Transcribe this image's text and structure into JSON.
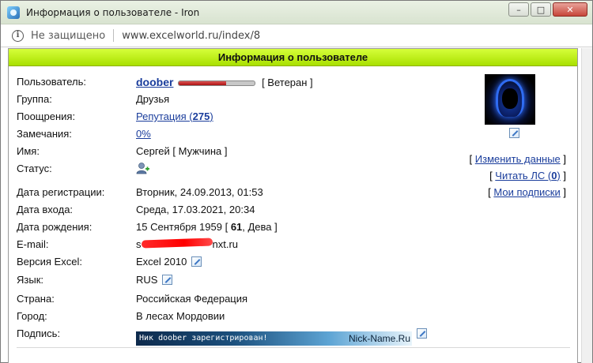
{
  "window": {
    "title": "Информация о пользователе - Iron",
    "controls": {
      "minimize": "–",
      "maximize": "□",
      "close": "✕"
    }
  },
  "address": {
    "security": "Не защищено",
    "url": "www.excelworld.ru/index/8"
  },
  "page": {
    "header": "Информация о пользователе"
  },
  "profile": {
    "username_label": "Пользователь:",
    "username": "doober",
    "reputation_bar_fill": 0.62,
    "rank": "[ Ветеран ]",
    "group_label": "Группа:",
    "group": "Друзья",
    "rewards_label": "Поощрения:",
    "reputation_prefix": "Репутация (",
    "reputation_value": "275",
    "reputation_suffix": ")",
    "warnings_label": "Замечания:",
    "warnings": "0%",
    "name_label": "Имя:",
    "name": "Сергей [ Мужчина ]",
    "status_label": "Статус:",
    "reg_label": "Дата регистрации:",
    "reg_date": "Вторник, 24.09.2013, 01:53",
    "login_label": "Дата входа:",
    "login_date": "Среда, 17.03.2021, 20:34",
    "birth_label": "Дата рождения:",
    "birth_prefix": "15 Сентября 1959 [ ",
    "birth_age": "61",
    "birth_suffix": ", Дева ]",
    "email_label": "E-mail:",
    "email_visible_start": "s",
    "email_visible_end": "nxt.ru",
    "excel_label": "Версия Excel:",
    "excel": "Excel 2010",
    "lang_label": "Язык:",
    "lang": "RUS",
    "country_label": "Страна:",
    "country": "Российская Федерация",
    "city_label": "Город:",
    "city": "В лесах Мордовии",
    "signature_label": "Подпись:",
    "signature_text": "Ник doober зарегистрирован!",
    "signature_brand": "Nick-Name.Ru"
  },
  "side": {
    "edit_data": "Изменить данные",
    "read_pm_prefix": "Читать ЛС (",
    "read_pm_count": "0",
    "read_pm_suffix": ")",
    "subscriptions": "Мои подписки"
  },
  "icons": [
    "info-icon",
    "edit-icon",
    "user-add-icon",
    "avatar-image",
    "app-icon"
  ],
  "colors": {
    "header_green": "#b5ee10",
    "link_blue": "#1a3d9c",
    "reputation_red": "#b22222"
  }
}
